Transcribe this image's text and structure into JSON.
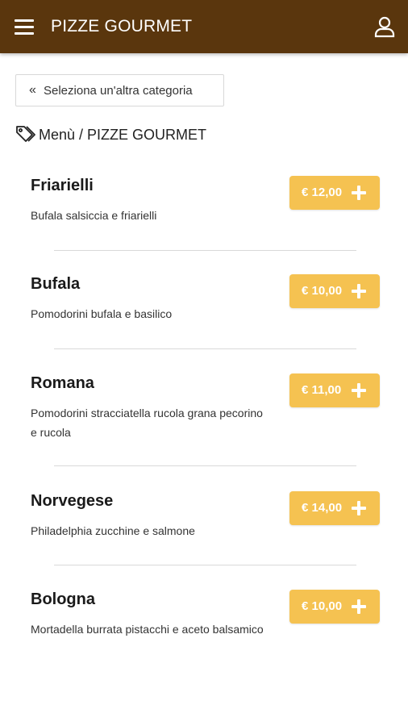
{
  "header": {
    "title": "PIZZE GOURMET",
    "menu_icon": "hamburger-icon",
    "user_icon": "user-icon"
  },
  "back": {
    "chevron": "«",
    "label": "Seleziona un'altra categoria"
  },
  "breadcrumb": {
    "icon": "tag-icon",
    "text": "Menù / PIZZE GOURMET"
  },
  "colors": {
    "header_bg": "#5a360d",
    "price_button": "#f5c251",
    "text": "#1c1c1c"
  },
  "items": [
    {
      "name": "Friarielli",
      "description": "Bufala salsiccia e friarielli",
      "price": "€ 12,00"
    },
    {
      "name": "Bufala",
      "description": "Pomodorini bufala e basilico",
      "price": "€ 10,00"
    },
    {
      "name": "Romana",
      "description": "Pomodorini stracciatella rucola grana pecorino e rucola",
      "price": "€ 11,00"
    },
    {
      "name": "Norvegese",
      "description": "Philadelphia zucchine e salmone",
      "price": "€ 14,00"
    },
    {
      "name": "Bologna",
      "description": "Mortadella burrata pistacchi e aceto balsamico",
      "price": "€ 10,00"
    }
  ]
}
